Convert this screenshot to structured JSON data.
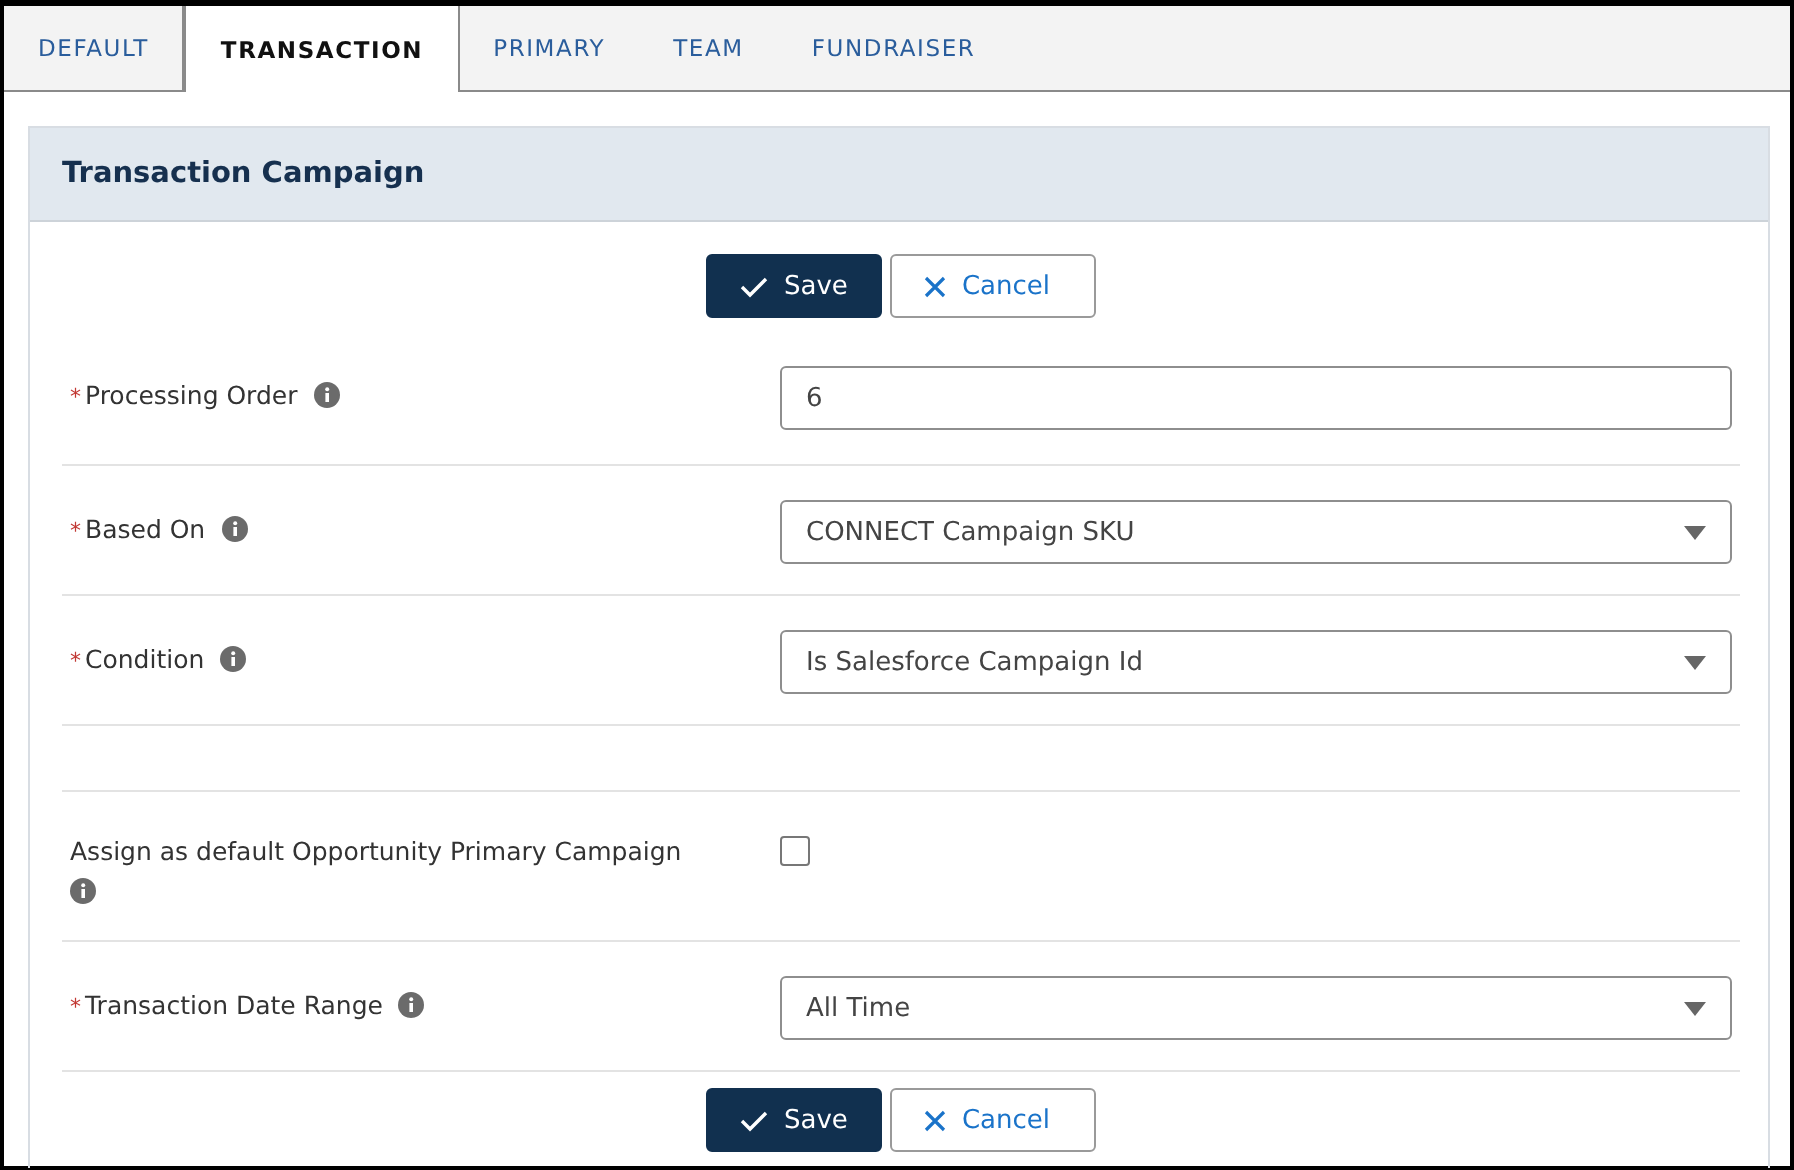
{
  "tabs": [
    {
      "label": "DEFAULT",
      "selected": false
    },
    {
      "label": "TRANSACTION",
      "selected": true
    },
    {
      "label": "PRIMARY",
      "selected": false
    },
    {
      "label": "TEAM",
      "selected": false
    },
    {
      "label": "FUNDRAISER",
      "selected": false
    }
  ],
  "panel": {
    "title": "Transaction Campaign",
    "required_mark": "*",
    "top_buttons": [
      {
        "label": "Save",
        "kind": "primary"
      },
      {
        "label": "Cancel",
        "kind": "secondary"
      }
    ],
    "fields": [
      {
        "kind": "text",
        "label": "Processing Order",
        "required": true,
        "value": "6"
      },
      {
        "kind": "select",
        "label": "Based On",
        "required": true,
        "value": "CONNECT Campaign SKU"
      },
      {
        "kind": "select",
        "label": "Condition",
        "required": true,
        "value": "Is Salesforce Campaign Id"
      },
      {
        "kind": "spacer"
      },
      {
        "kind": "checkbox",
        "label": "Assign as default Opportunity Primary Campaign",
        "required": false,
        "checked": false
      },
      {
        "kind": "select",
        "label": "Transaction Date Range",
        "required": true,
        "value": "All Time"
      }
    ],
    "bottom_buttons": [
      {
        "label": "Save",
        "kind": "primary"
      },
      {
        "label": "Cancel",
        "kind": "secondary"
      }
    ]
  }
}
